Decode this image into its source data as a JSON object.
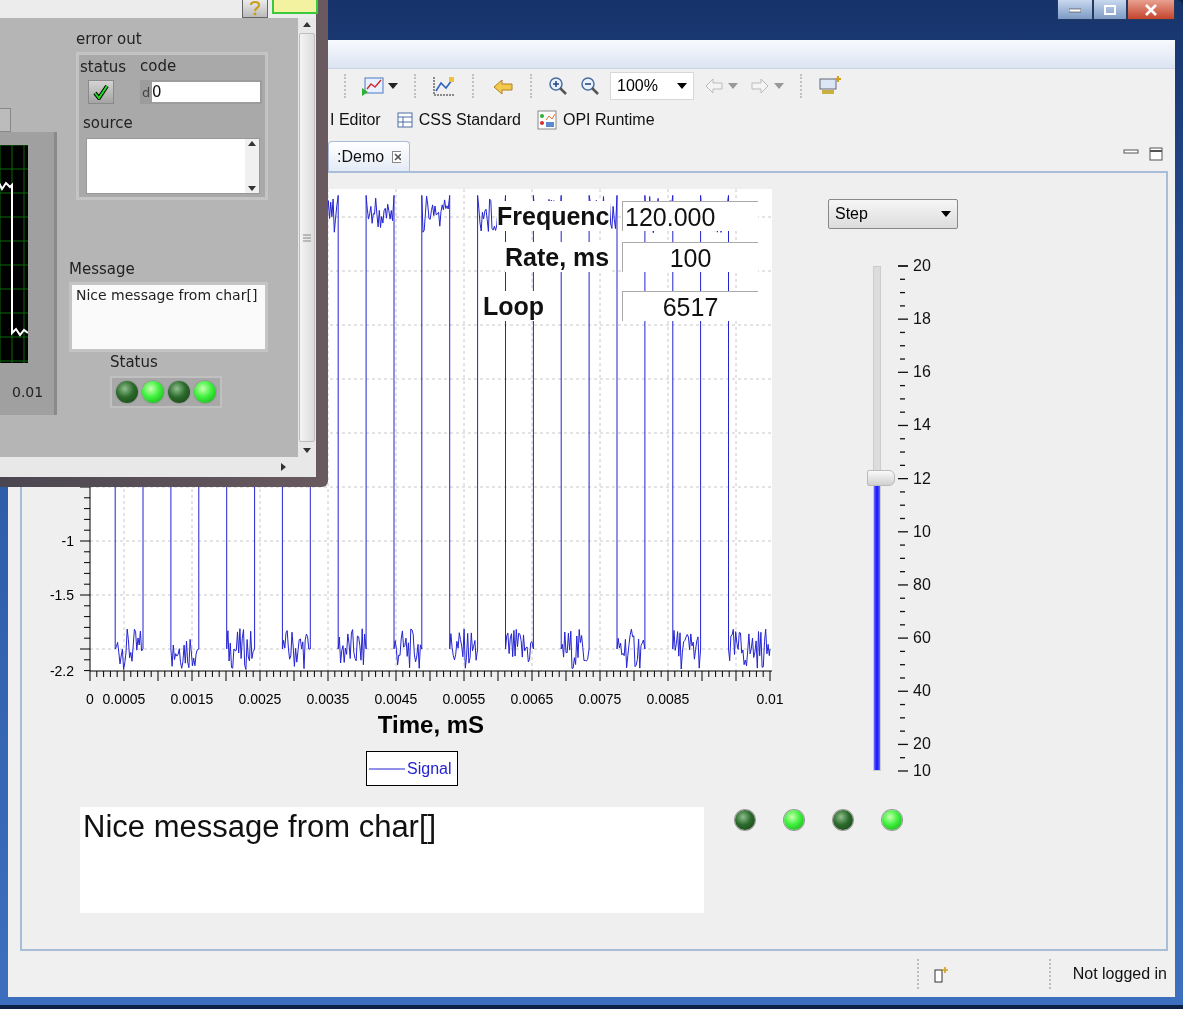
{
  "eclipse": {
    "toolbar": {
      "zoom": "100%"
    },
    "perspectives": [
      {
        "label": "I Editor"
      },
      {
        "label": "CSS Standard"
      },
      {
        "label": "OPI Runtime"
      }
    ],
    "tab": {
      "label": ":Demo"
    },
    "plot": {
      "xtick_labels": [
        "0",
        "0.0005",
        "0.0015",
        "0.0025",
        "0.0035",
        "0.0045",
        "0.0055",
        "0.0065",
        "0.0075",
        "0.0085",
        "0.01"
      ],
      "ytick_labels": [
        "-1",
        "-1.5",
        "-2.2"
      ],
      "xlabel": "Time, mS",
      "legend": "Signal"
    },
    "readouts": [
      {
        "label": "Frequenc",
        "value": "120.000"
      },
      {
        "label": "Rate, ms",
        "value": "100"
      },
      {
        "label": "Loop",
        "value": "6517"
      }
    ],
    "mode_select": {
      "value": "Step"
    },
    "slider": {
      "level": 0.58,
      "scale": [
        "20",
        "18",
        "16",
        "14",
        "12",
        "10",
        "80",
        "60",
        "40",
        "20",
        "10"
      ]
    },
    "message": "Nice message from char[]",
    "leds": [
      {
        "on": false
      },
      {
        "on": true
      },
      {
        "on": false
      },
      {
        "on": true
      }
    ],
    "status_bar": {
      "login": "Not logged in"
    }
  },
  "labview": {
    "error_out": {
      "title": "error out",
      "status_label": "status",
      "status_error": false,
      "code_label": "code",
      "radix": "d",
      "code": "0",
      "source_label": "source"
    },
    "graph_tick": "0.01",
    "message_label": "Message",
    "message": "Nice message from char[]",
    "status_label": "Status",
    "leds": [
      {
        "on": false
      },
      {
        "on": true
      },
      {
        "on": false
      },
      {
        "on": true
      }
    ]
  }
}
